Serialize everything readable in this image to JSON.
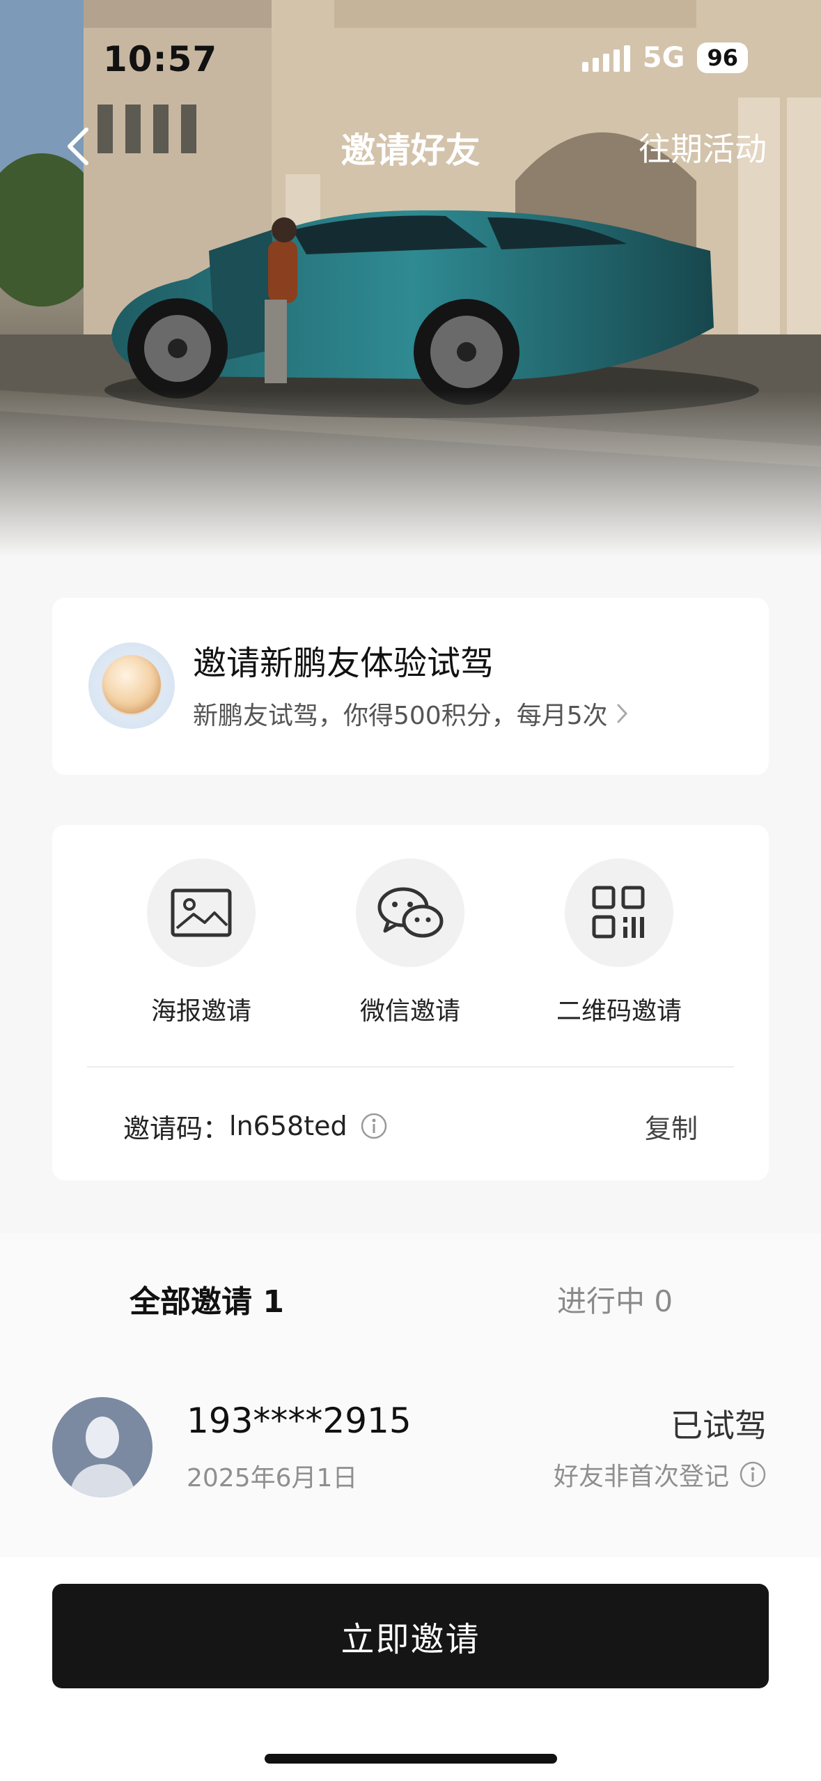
{
  "status_bar": {
    "time": "10:57",
    "network": "5G",
    "battery": "96"
  },
  "nav": {
    "title": "邀请好友",
    "right_link": "往期活动",
    "back_icon": "chevron-left-icon"
  },
  "promo": {
    "title": "邀请新鹏友体验试驾",
    "subtitle": "新鹏友试驾，你得500积分，每月5次",
    "icon": "coin-icon"
  },
  "invite_methods": [
    {
      "label": "海报邀请",
      "icon": "image-icon"
    },
    {
      "label": "微信邀请",
      "icon": "wechat-icon"
    },
    {
      "label": "二维码邀请",
      "icon": "qr-code-icon"
    }
  ],
  "invite_code": {
    "label": "邀请码：",
    "value": "ln658ted",
    "copy_label": "复制"
  },
  "tabs": {
    "all": "全部邀请 1",
    "in_progress": "进行中 0"
  },
  "invites": [
    {
      "phone": "193****2915",
      "date": "2025年6月1日",
      "status": "已试驾",
      "note": "好友非首次登记"
    }
  ],
  "cta_label": "立即邀请",
  "colors": {
    "cta_background": "#151515",
    "card_background": "#ffffff",
    "page_background": "#f7f7f7"
  }
}
